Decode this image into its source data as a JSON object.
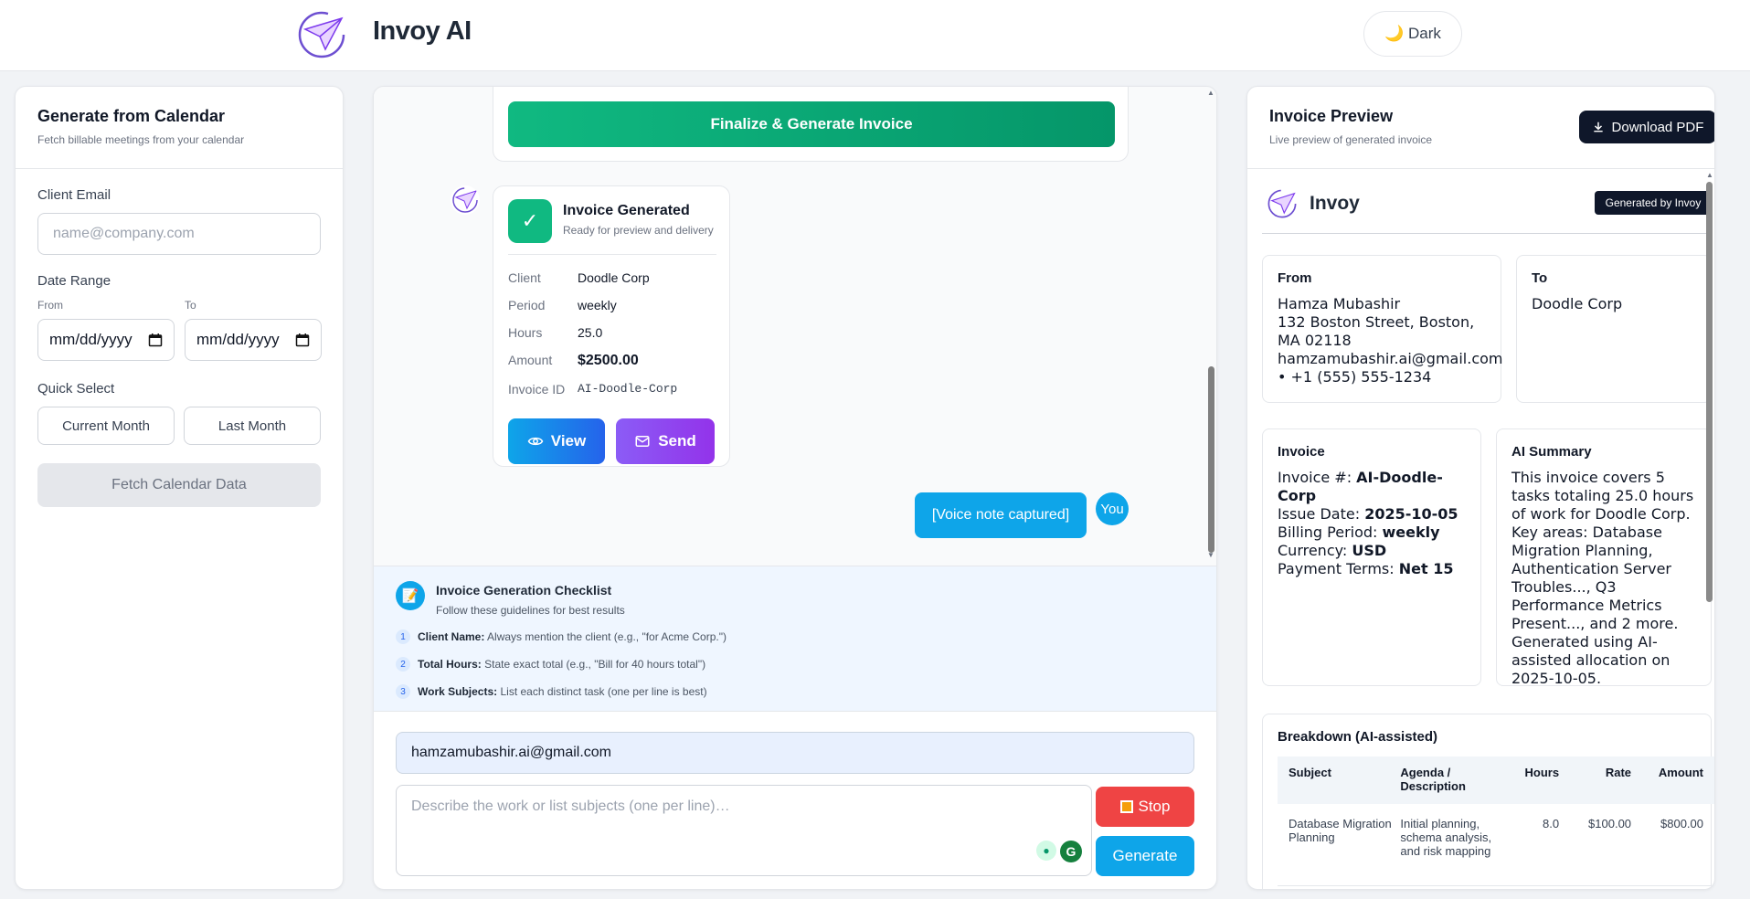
{
  "header": {
    "app_title": "Invoy AI",
    "theme_toggle": "🌙 Dark"
  },
  "calendar": {
    "title": "Generate from Calendar",
    "subtitle": "Fetch billable meetings from your calendar",
    "client_email_label": "Client Email",
    "client_email_placeholder": "name@company.com",
    "date_range_label": "Date Range",
    "from_label": "From",
    "to_label": "To",
    "from_value": "mm/dd/yyyy",
    "to_value": "mm/dd/yyyy",
    "quick_select_label": "Quick Select",
    "current_month": "Current Month",
    "last_month": "Last Month",
    "fetch_button": "Fetch Calendar Data"
  },
  "chat": {
    "finalize_button": "Finalize & Generate Invoice",
    "invoice_card": {
      "title": "Invoice Generated",
      "subtitle": "Ready for preview and delivery",
      "client_label": "Client",
      "client_value": "Doodle Corp",
      "period_label": "Period",
      "period_value": "weekly",
      "hours_label": "Hours",
      "hours_value": "25.0",
      "amount_label": "Amount",
      "amount_value": "$2500.00",
      "invoice_id_label": "Invoice ID",
      "invoice_id_value": "AI-Doodle-Corp",
      "view_button": "View",
      "send_button": "Send"
    },
    "user_message": "[Voice note captured]",
    "user_avatar": "You"
  },
  "checklist": {
    "icon": "📝",
    "title": "Invoice Generation Checklist",
    "subtitle": "Follow these guidelines for best results",
    "items": [
      {
        "num": "1",
        "label": "Client Name:",
        "text": "Always mention the client (e.g., \"for Acme Corp.\")"
      },
      {
        "num": "2",
        "label": "Total Hours:",
        "text": "State exact total (e.g., \"Bill for 40 hours total\")"
      },
      {
        "num": "3",
        "label": "Work Subjects:",
        "text": "List each distinct task (one per line is best)"
      }
    ]
  },
  "composer": {
    "email_value": "hamzamubashir.ai@gmail.com",
    "description_placeholder": "Describe the work or list subjects (one per line)…",
    "stop_button": "Stop",
    "generate_button": "Generate"
  },
  "preview": {
    "title": "Invoice Preview",
    "subtitle": "Live preview of generated invoice",
    "download_button": "Download PDF",
    "brand": "Invoy",
    "generated_badge": "Generated by Invoy",
    "from": {
      "heading": "From",
      "name": "Hamza Mubashir",
      "address": "132 Boston Street, Boston, MA 02118",
      "email": "hamzamubashir.ai@gmail.com",
      "phone": "• +1 (555) 555-1234"
    },
    "to": {
      "heading": "To",
      "name": "Doodle Corp"
    },
    "invoice": {
      "heading": "Invoice",
      "number_label": "Invoice #: ",
      "number_value": "AI-Doodle-Corp",
      "issue_label": "Issue Date: ",
      "issue_value": "2025-10-05",
      "period_label": "Billing Period: ",
      "period_value": "weekly",
      "currency_label": "Currency: ",
      "currency_value": "USD",
      "terms_label": "Payment Terms: ",
      "terms_value": "Net 15"
    },
    "summary": {
      "heading": "AI Summary",
      "text": "This invoice covers 5 tasks totaling 25.0 hours of work for Doodle Corp. Key areas: Database Migration Planning, Authentication Server Troubles..., Q3 Performance Metrics Present..., and 2 more. Generated using AI-assisted allocation on 2025-10-05."
    },
    "breakdown": {
      "heading": "Breakdown (AI-assisted)",
      "columns": [
        "Subject",
        "Agenda / Description",
        "Hours",
        "Rate",
        "Amount"
      ],
      "rows": [
        {
          "subject": "Database Migration Planning",
          "description": "Initial planning, schema analysis, and risk mapping",
          "hours": "8.0",
          "rate": "$100.00",
          "amount": "$800.00"
        }
      ]
    }
  }
}
